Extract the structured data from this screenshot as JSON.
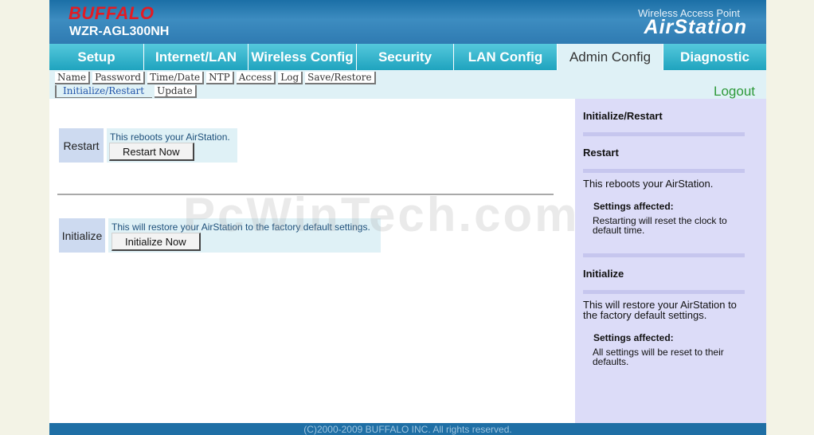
{
  "header": {
    "brand": "BUFFALO",
    "model": "WZR-AGL300NH",
    "subtitle": "Wireless Access Point",
    "product": "AirStation"
  },
  "tabs": [
    {
      "label": "Setup"
    },
    {
      "label": "Internet/LAN"
    },
    {
      "label": "Wireless Config"
    },
    {
      "label": "Security"
    },
    {
      "label": "LAN Config"
    },
    {
      "label": "Admin Config"
    },
    {
      "label": "Diagnostic"
    }
  ],
  "subtabs": {
    "row1": [
      "Name",
      "Password",
      "Time/Date",
      "NTP",
      "Access",
      "Log",
      "Save/Restore"
    ],
    "row2": [
      "Initialize/Restart",
      "Update"
    ]
  },
  "logout": "Logout",
  "restart": {
    "label": "Restart",
    "desc": "This reboots your AirStation.",
    "button": "Restart Now"
  },
  "initialize": {
    "label": "Initialize",
    "desc": "This will restore your AirStation to the factory default settings.",
    "button": "Initialize Now"
  },
  "watermark": "PcWinTech.com",
  "help": {
    "title": "Initialize/Restart",
    "restart_heading": "Restart",
    "restart_text": "This reboots your AirStation.",
    "restart_affected_label": "Settings affected:",
    "restart_affected_text": "Restarting will reset the clock to default time.",
    "initialize_heading": "Initialize",
    "initialize_text": "This will restore your AirStation to the factory default settings.",
    "initialize_affected_label": "Settings affected:",
    "initialize_affected_text": "All settings will be reset to their defaults."
  },
  "footer": "(C)2000-2009 BUFFALO INC. All rights reserved."
}
